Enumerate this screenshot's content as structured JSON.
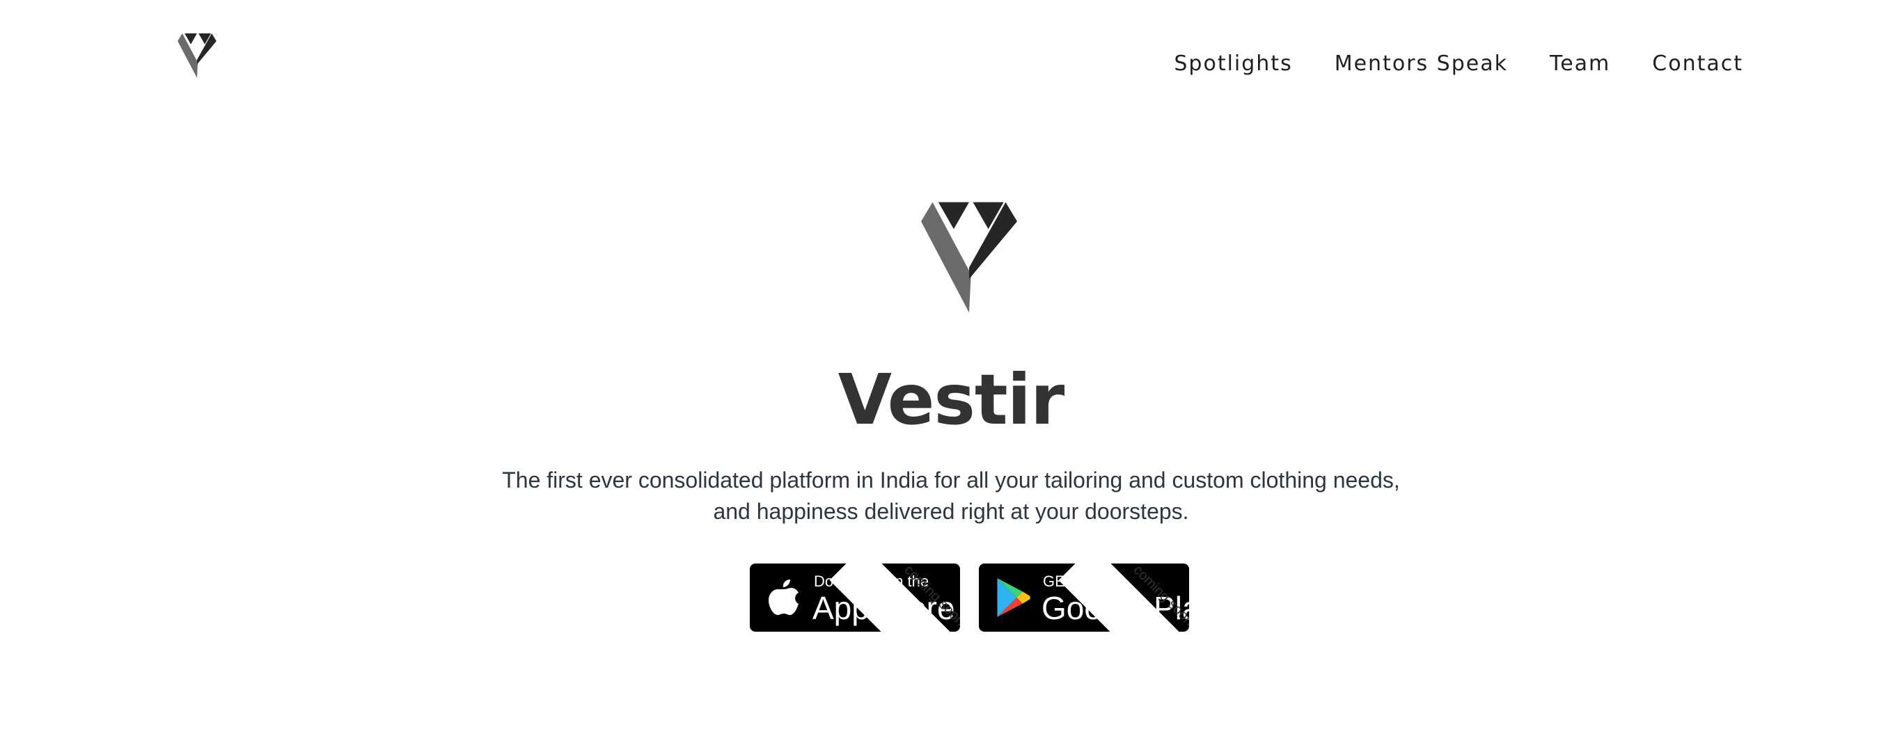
{
  "header": {
    "logo_icon": "vestir-logo-icon",
    "nav": [
      {
        "label": "Spotlights"
      },
      {
        "label": "Mentors Speak"
      },
      {
        "label": "Team"
      },
      {
        "label": "Contact"
      }
    ]
  },
  "hero": {
    "logo_icon": "vestir-logo-icon",
    "title": "Vestir",
    "tagline_line1": "The first ever consolidated platform in India for all your tailoring and custom clothing needs,",
    "tagline_line2": "and happiness delivered right at your doorsteps."
  },
  "stores": {
    "apple": {
      "icon": "apple-icon",
      "small_text": "Download on the",
      "big_text": "App Store",
      "badge": "coming soon"
    },
    "google": {
      "icon": "google-play-icon",
      "small_text": "GET IT ON",
      "big_text": "Google Play",
      "badge": "coming soon"
    }
  },
  "colors": {
    "logo_light": "#6b6b6b",
    "logo_dark": "#262626",
    "title": "#333333",
    "tagline": "#2d3540",
    "badge_bg": "#000000"
  }
}
